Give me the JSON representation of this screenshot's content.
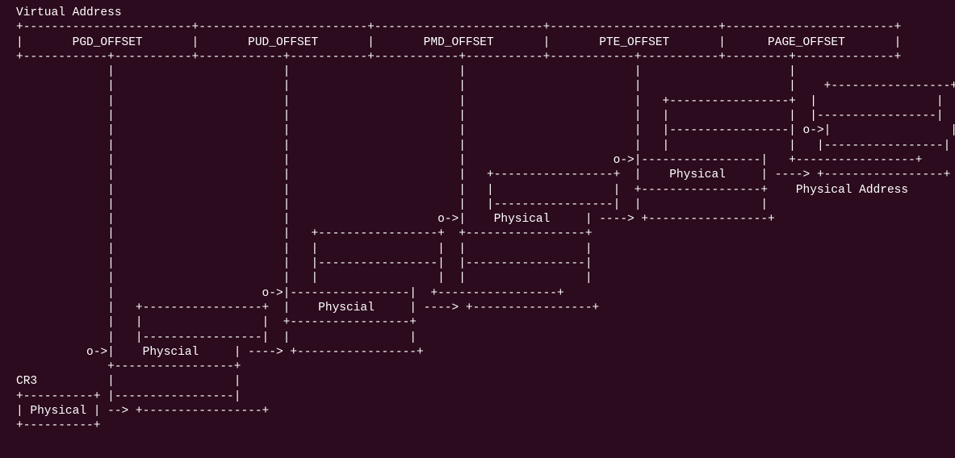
{
  "title": "Virtual Address",
  "offsets": [
    "PGD_OFFSET",
    "PUD_OFFSET",
    "PMD_OFFSET",
    "PTE_OFFSET",
    "PAGE_OFFSET"
  ],
  "tables": {
    "pgd_entry": "Physcial",
    "pud_entry": "Physcial",
    "pmd_entry": "Physical",
    "pte_entry": "Physical"
  },
  "register": {
    "name": "CR3",
    "entry": "Physical"
  },
  "final_label": "Physical Address",
  "lines": [
    "Virtual Address",
    "+------------------------+------------------------+------------------------+------------------------+------------------------+",
    "|       {OFF0}       |       {OFF1}       |       {OFF2}       |       {OFF3}       |      {OFF4}       |",
    "+------------+-----------+------------+-----------+------------+-----------+------------+-----------+---------+--------------+",
    "             |                        |                        |                        |                     |",
    "             |                        |                        |                        |                     |    +-----------------+",
    "             |                        |                        |                        |   +-----------------+  |                 |",
    "             |                        |                        |                        |   |                 |  |-----------------|",
    "             |                        |                        |                        |   |-----------------| o->|                 |",
    "             |                        |                        |                        |   |                 |   |-----------------|",
    "             |                        |                        |                     o->|-----------------|   +-----------------+",
    "             |                        |                        |   +-----------------+  |    {PTE}     | ----> +-----------------+",
    "             |                        |                        |   |                 |  +-----------------+    {FINAL}",
    "             |                        |                        |   |-----------------|  |                 |",
    "             |                        |                     o->|    {PMD}     | ----> +-----------------+",
    "             |                        |   +-----------------+  +-----------------+",
    "             |                        |   |                 |  |                 |",
    "             |                        |   |-----------------|  |-----------------|",
    "             |                        |   |                 |  |                 |",
    "             |                     o->|-----------------|  +-----------------+",
    "             |   +-----------------+  |    {PUD}     | ----> +-----------------+",
    "             |   |                 |  +-----------------+",
    "             |   |-----------------|  |                 |",
    "          o->|    {PGD}     | ----> +-----------------+",
    "             +-----------------+",
    "{CR3}          |                 |",
    "+----------+ |-----------------|",
    "| {CR3E} | --> +-----------------+",
    "+----------+"
  ]
}
